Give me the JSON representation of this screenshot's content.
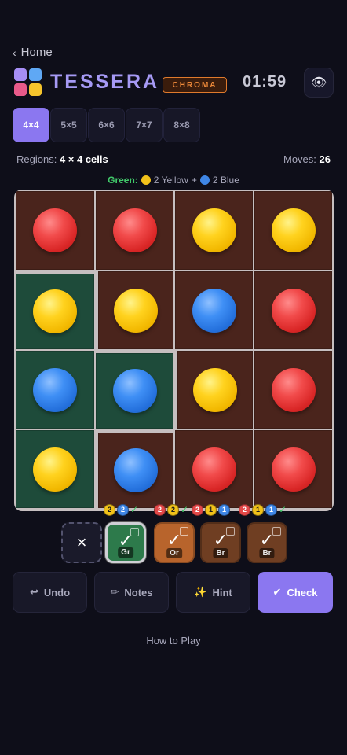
{
  "nav": {
    "back_label": "Home"
  },
  "header": {
    "title": "TESSERA",
    "badge": "CHROMA",
    "timer": "01:59",
    "logo_colors": [
      "#a68ef5",
      "#5fa8f5",
      "#e85a8a",
      "#f5c42c"
    ]
  },
  "size_tabs": [
    {
      "label": "4×4",
      "active": true
    },
    {
      "label": "5×5",
      "active": false
    },
    {
      "label": "6×6",
      "active": false
    },
    {
      "label": "7×7",
      "active": false
    },
    {
      "label": "8×8",
      "active": false
    }
  ],
  "info": {
    "regions_label": "Regions:",
    "regions_value": "4 × 4 cells",
    "moves_label": "Moves:",
    "moves_value": "26"
  },
  "hint_line": {
    "region": "Green:",
    "part1": "2 Yellow",
    "plus": "+",
    "part2": "2 Blue"
  },
  "board": {
    "rows": 4,
    "cols": 4,
    "colors": {
      "red": "#e53e3e",
      "yellow": "#f7c400",
      "blue": "#2f7ce8",
      "green_region": "#1e4b3a",
      "brown_region": "#4a241c"
    },
    "cells": [
      [
        "red",
        "red",
        "yellow",
        "yellow"
      ],
      [
        "yellow",
        "yellow",
        "blue",
        "red"
      ],
      [
        "blue",
        "blue",
        "yellow",
        "red"
      ],
      [
        "yellow",
        "blue",
        "red",
        "red"
      ]
    ],
    "regions": [
      [
        "br",
        "br",
        "br",
        "br"
      ],
      [
        "gr",
        "br",
        "br",
        "br"
      ],
      [
        "gr",
        "gr",
        "br",
        "br"
      ],
      [
        "gr",
        "br",
        "br",
        "br"
      ]
    ]
  },
  "trays": {
    "clear_label": "×",
    "items": [
      {
        "label": "Gr",
        "color": "green",
        "counts": [
          "2",
          "2"
        ],
        "count_colors": [
          "y",
          "b"
        ]
      },
      {
        "label": "Or",
        "color": "orange",
        "counts": [
          "2",
          "2"
        ],
        "count_colors": [
          "r",
          "y"
        ]
      },
      {
        "label": "Br",
        "color": "brown",
        "counts": [
          "2",
          "1",
          "1"
        ],
        "count_colors": [
          "r",
          "y",
          "b"
        ]
      },
      {
        "label": "Br",
        "color": "brown",
        "counts": [
          "2",
          "1",
          "1"
        ],
        "count_colors": [
          "r",
          "y",
          "b"
        ]
      }
    ]
  },
  "actions": {
    "undo": "Undo",
    "notes": "Notes",
    "hint": "Hint",
    "check": "Check"
  },
  "footer": {
    "how_to_play": "How to Play"
  }
}
